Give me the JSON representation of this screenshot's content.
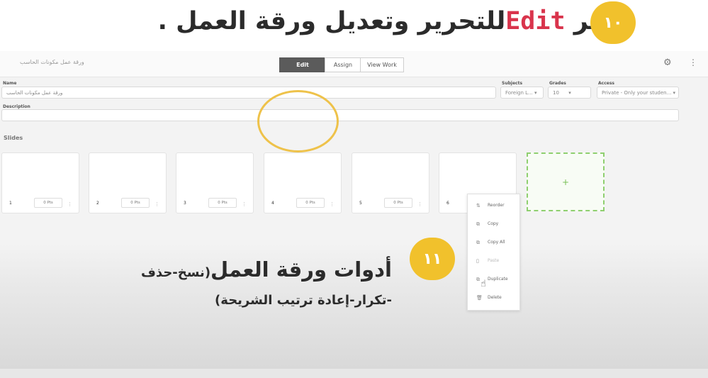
{
  "header": {
    "step_number": "١٠",
    "title_prefix": "اختر",
    "title_edit": "Edit",
    "title_suffix": "للتحرير وتعديل ورقة العمل ."
  },
  "app": {
    "worksheet_title": "ورقة عمل مكونات الحاسب",
    "tabs": [
      {
        "label": "Edit",
        "active": true
      },
      {
        "label": "Assign",
        "active": false
      },
      {
        "label": "View Work",
        "active": false
      }
    ],
    "gear_icon": "gear-icon",
    "fields": {
      "name_label": "Name",
      "name_value": "ورقة عمل مكونات الحاسب",
      "subjects_label": "Subjects",
      "subjects_value": "Foreign L...",
      "grades_label": "Grades",
      "grades_value": "10",
      "access_label": "Access",
      "access_value": "Private - Only your studen...",
      "description_label": "Description",
      "description_value": ""
    },
    "slides_title": "Slides",
    "slides": [
      {
        "num": "1",
        "pts": "0 Pts"
      },
      {
        "num": "2",
        "pts": "0 Pts"
      },
      {
        "num": "3",
        "pts": "0 Pts"
      },
      {
        "num": "4",
        "pts": "0 Pts"
      },
      {
        "num": "5",
        "pts": "0 Pts"
      },
      {
        "num": "6",
        "pts": ""
      }
    ],
    "add_slide": "+",
    "context_menu": [
      {
        "label": "Reorder",
        "icon": "reorder-icon",
        "disabled": false
      },
      {
        "label": "Copy",
        "icon": "copy-icon",
        "disabled": false
      },
      {
        "label": "Copy All",
        "icon": "copy-all-icon",
        "disabled": false
      },
      {
        "label": "Paste",
        "icon": "paste-icon",
        "disabled": true
      },
      {
        "label": "Duplicate",
        "icon": "duplicate-icon",
        "disabled": false
      },
      {
        "label": "Delete",
        "icon": "trash-icon",
        "disabled": false
      }
    ]
  },
  "step2": {
    "step_number": "١١",
    "title_main": "أدوات ورقة العمل",
    "title_paren": "(نسخ-حذف",
    "subtitle": "-تكرار-إعادة ترتيب الشريحة)"
  },
  "colors": {
    "badge": "#f1c12c",
    "edit_word": "#d9344c",
    "ring": "#eec24a",
    "add_slide_border": "#8fcf6f"
  }
}
